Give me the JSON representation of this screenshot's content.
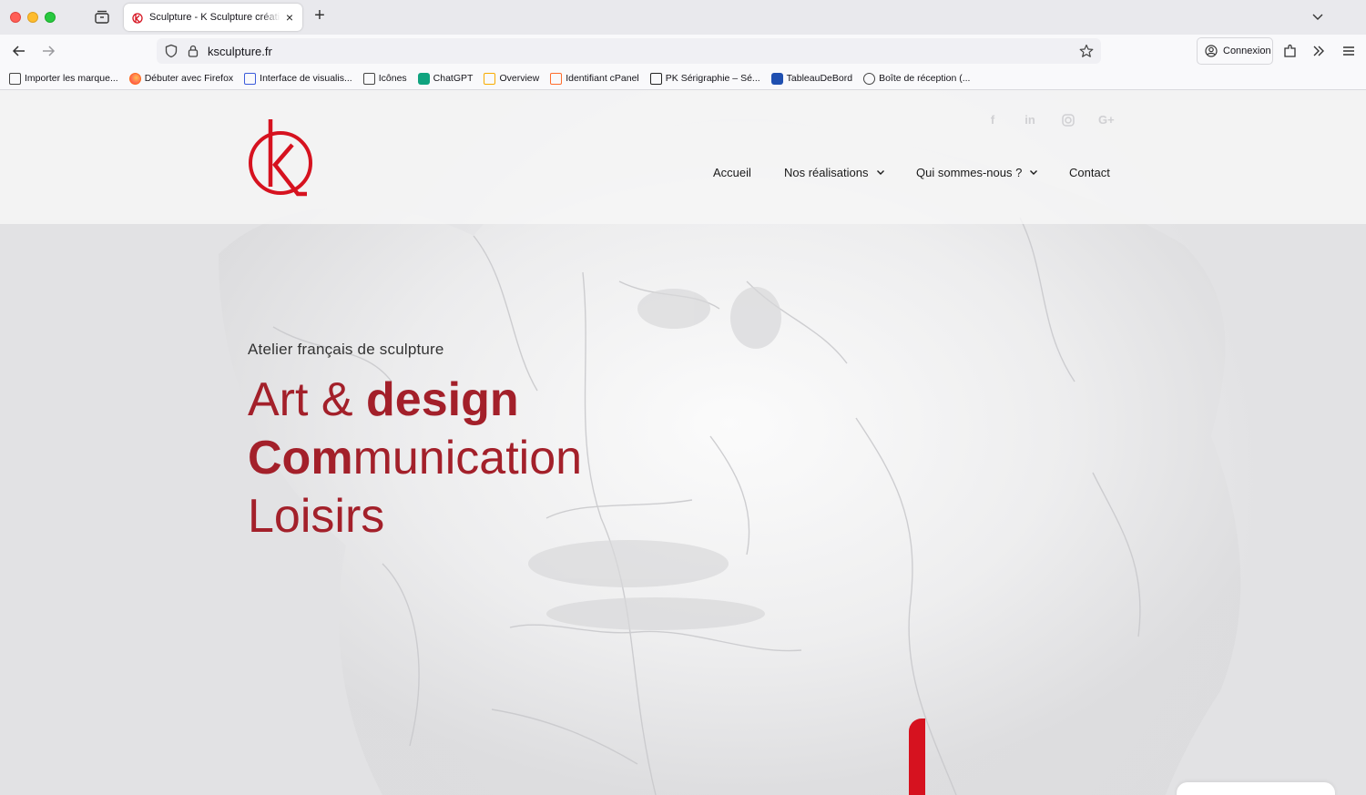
{
  "browser": {
    "tab_title": "Sculpture - K Sculpture création",
    "url": "ksculpture.fr",
    "account_label": "Connexion",
    "bookmarks": [
      {
        "label": "Importer les marque...",
        "icon": "import-icon"
      },
      {
        "label": "Débuter avec Firefox",
        "icon": "firefox-icon"
      },
      {
        "label": "Interface de visualis...",
        "icon": "yc-icon"
      },
      {
        "label": "Icônes",
        "icon": "hand-icon"
      },
      {
        "label": "ChatGPT",
        "icon": "chatgpt-icon"
      },
      {
        "label": "Overview",
        "icon": "analytics-icon"
      },
      {
        "label": "Identifiant cPanel",
        "icon": "cpanel-icon"
      },
      {
        "label": "PK Sérigraphie – Sé...",
        "icon": "pk-icon"
      },
      {
        "label": "TableauDeBord",
        "icon": "dashboard-icon"
      },
      {
        "label": "Boîte de réception (...",
        "icon": "globe-icon"
      }
    ]
  },
  "site": {
    "social": [
      {
        "label": "f",
        "icon": "facebook-icon"
      },
      {
        "label": "in",
        "icon": "linkedin-icon"
      },
      {
        "label": "",
        "icon": "instagram-icon"
      },
      {
        "label": "G+",
        "icon": "google-plus-icon"
      }
    ],
    "nav": {
      "home": "Accueil",
      "works": "Nos réalisations",
      "about": "Qui sommes-nous ?",
      "contact": "Contact"
    },
    "hero": {
      "eyebrow": "Atelier français de sculpture",
      "line1_regular": "Art & ",
      "line1_bold": "design",
      "line2_bold": "Com",
      "line2_regular": "munication",
      "line3": "Loisirs"
    }
  },
  "colors": {
    "brand_red": "#d6121f",
    "hero_text_red": "#a3202a"
  }
}
